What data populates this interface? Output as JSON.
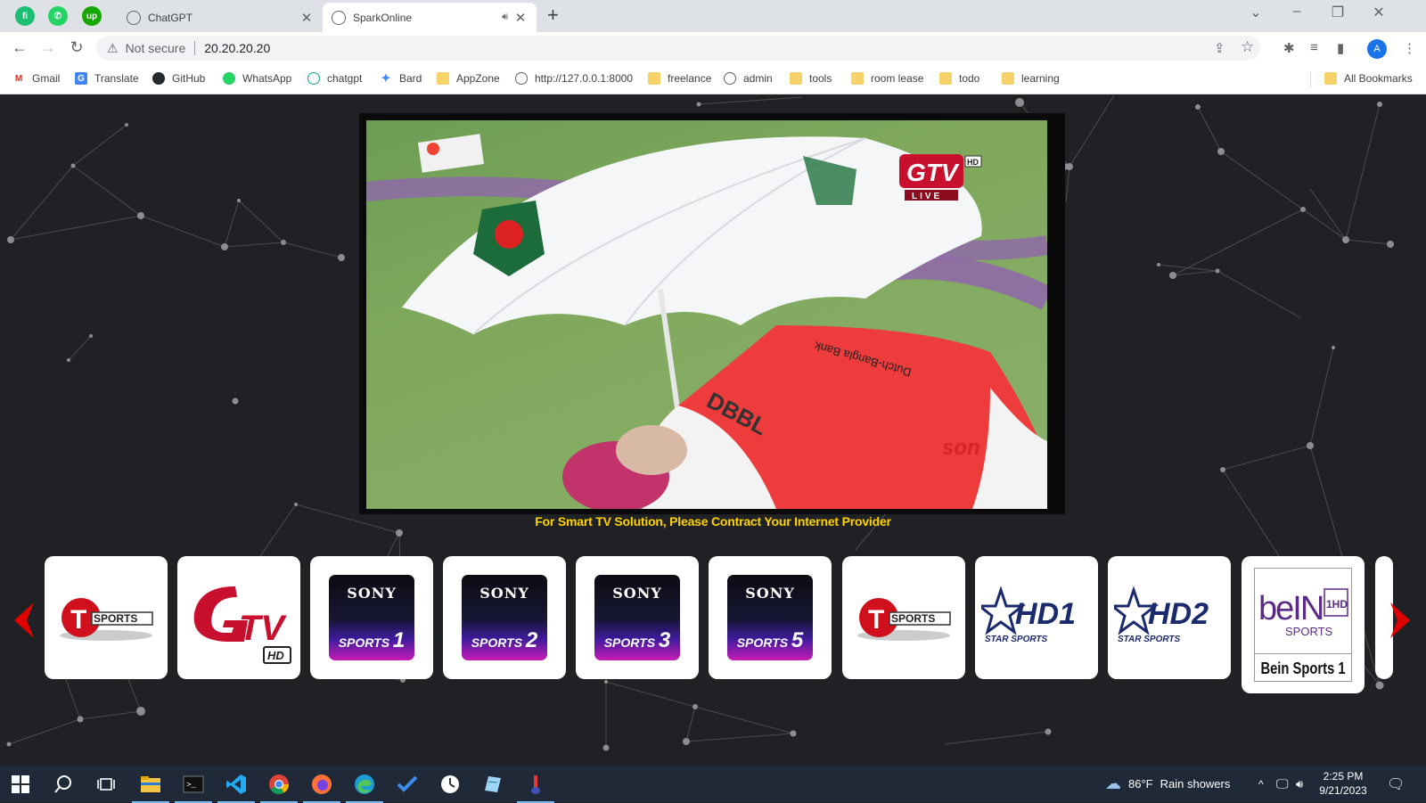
{
  "browser": {
    "pinned_tabs": [
      {
        "icon": "fiverr-icon",
        "glyph": "fi",
        "color": "#1dbf73"
      },
      {
        "icon": "whatsapp-icon",
        "glyph": "✆",
        "color": "#25d366"
      },
      {
        "icon": "upwork-icon",
        "glyph": "up",
        "color": "#14a800"
      }
    ],
    "tabs": [
      {
        "title": "ChatGPT",
        "icon": "chatgpt-icon",
        "active": false
      },
      {
        "title": "SparkOnline",
        "icon": "globe-icon",
        "active": true,
        "audio": true
      }
    ],
    "address": {
      "security_label": "Not secure",
      "url": "20.20.20.20"
    },
    "profile_initial": "A",
    "bookmarks": [
      {
        "label": "Gmail",
        "icon": "gmail-icon"
      },
      {
        "label": "Translate",
        "icon": "translate-icon"
      },
      {
        "label": "GitHub",
        "icon": "github-icon"
      },
      {
        "label": "WhatsApp",
        "icon": "whatsapp-icon"
      },
      {
        "label": "chatgpt",
        "icon": "chatgpt-icon"
      },
      {
        "label": "Bard",
        "icon": "bard-icon"
      },
      {
        "label": "AppZone",
        "icon": "folder-icon"
      },
      {
        "label": "http://127.0.0.1:8000",
        "icon": "globe-icon"
      },
      {
        "label": "freelance",
        "icon": "folder-icon"
      },
      {
        "label": "admin",
        "icon": "globe-icon"
      },
      {
        "label": "tools",
        "icon": "folder-icon"
      },
      {
        "label": "room lease",
        "icon": "folder-icon"
      },
      {
        "label": "todo",
        "icon": "folder-icon"
      },
      {
        "label": "learning",
        "icon": "folder-icon"
      }
    ],
    "all_bookmarks_label": "All Bookmarks"
  },
  "player": {
    "live_label": "LIVE",
    "banner_text": "Dutch-Bangla Bank",
    "banner_short": "DBBL"
  },
  "page": {
    "provider_note": "For Smart TV Solution, Please Contract Your Internet Provider"
  },
  "channels": [
    {
      "name": "T Sports",
      "logo": "tsports",
      "text": "SPORTS"
    },
    {
      "name": "GTV HD",
      "logo": "gtv",
      "text": "HD"
    },
    {
      "name": "Sony Sports Ten 1",
      "logo": "sony",
      "brand": "SONY",
      "line": "SPORTS",
      "number": "1"
    },
    {
      "name": "Sony Sports Ten 2",
      "logo": "sony",
      "brand": "SONY",
      "line": "SPORTS",
      "number": "2"
    },
    {
      "name": "Sony Sports Ten 3",
      "logo": "sony",
      "brand": "SONY",
      "line": "SPORTS",
      "number": "3"
    },
    {
      "name": "Sony Sports Ten 5",
      "logo": "sony",
      "brand": "SONY",
      "line": "SPORTS",
      "number": "5"
    },
    {
      "name": "T Sports",
      "logo": "tsports",
      "text": "SPORTS"
    },
    {
      "name": "Star Sports HD1",
      "logo": "star",
      "text": "HD1",
      "sub": "STAR SPORTS"
    },
    {
      "name": "Star Sports HD2",
      "logo": "star",
      "text": "HD2",
      "sub": "STAR SPORTS"
    },
    {
      "name": "Bein Sports 1",
      "logo": "bein",
      "brand": "beIN",
      "sub": "SPORTS",
      "badge": "1HD",
      "label": "Bein Sports 1"
    }
  ],
  "taskbar": {
    "apps": [
      "start-icon",
      "search-icon",
      "task-view-icon",
      "file-explorer-icon",
      "terminal-icon",
      "vscode-icon",
      "chrome-icon",
      "firefox-icon",
      "edge-icon",
      "todo-icon",
      "clock-app-icon",
      "notepad-icon",
      "paint-icon"
    ],
    "weather": {
      "temp": "86°F",
      "condition": "Rain showers"
    },
    "time": "2:25 PM",
    "date": "9/21/2023"
  },
  "colors": {
    "accent_yellow": "#ffd200",
    "arrow_red": "#e00000",
    "page_bg": "#202124"
  }
}
